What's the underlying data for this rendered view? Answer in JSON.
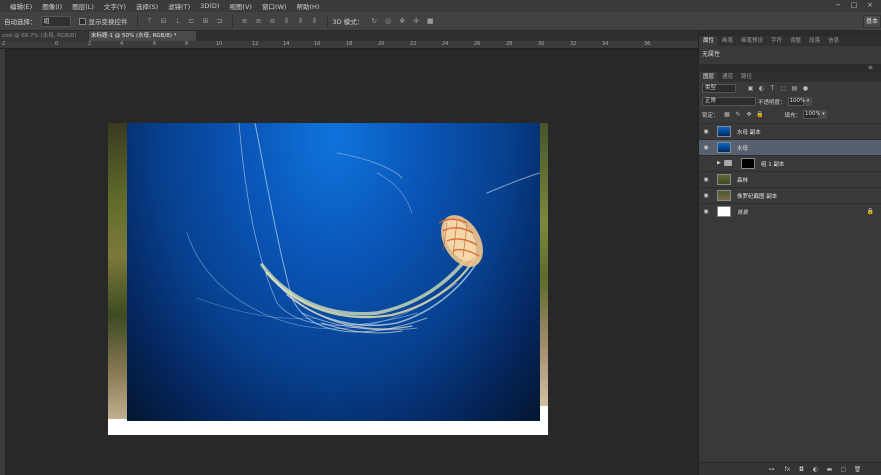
{
  "menu": {
    "items": [
      "编辑(E)",
      "图像(I)",
      "图层(L)",
      "文字(Y)",
      "选择(S)",
      "滤镜(T)",
      "3D(D)",
      "视图(V)",
      "窗口(W)",
      "帮助(H)"
    ],
    "window_buttons": [
      "−",
      "□",
      "×"
    ]
  },
  "options": {
    "auto_select_label": "自动选择：",
    "auto_select_value": "组",
    "show_transform_label": "显示变换控件",
    "mode_3d_label": "3D 模式：",
    "workspace": "基本"
  },
  "tabs": [
    {
      "label": "ood @ 66.7% (水母, RGB/8)",
      "active": false
    },
    {
      "label": "未标题-1 @ 50% (水母, RGB/8) *",
      "active": true
    }
  ],
  "ruler": {
    "ticks": [
      "2",
      "0",
      "2",
      "4",
      "6",
      "8",
      "10",
      "12",
      "14",
      "16",
      "18",
      "20",
      "22",
      "24",
      "26",
      "28",
      "30",
      "32",
      "34",
      "36"
    ]
  },
  "properties_panel": {
    "tabs": [
      "属性",
      "画笔",
      "画笔预设",
      "字符",
      "调整",
      "段落",
      "信息"
    ],
    "empty_text": "无属性"
  },
  "layers_panel": {
    "tabs": [
      "图层",
      "通道",
      "路径"
    ],
    "filter_kind": "类型",
    "blend_mode": "正常",
    "opacity_label": "不透明度：",
    "opacity_value": "100%",
    "lock_label": "锁定：",
    "fill_label": "填充：",
    "fill_value": "100%",
    "layers": [
      {
        "name": "水母 副本",
        "selected": false
      },
      {
        "name": "水母",
        "selected": true
      },
      {
        "name": "组 1 副本",
        "selected": false
      },
      {
        "name": "森林",
        "selected": false
      },
      {
        "name": "侏罗纪截图 副本",
        "selected": false
      },
      {
        "name": "背景",
        "selected": false
      }
    ]
  },
  "colors": {
    "selection": "#56606e",
    "panel": "#393939",
    "canvas": "#282828"
  }
}
